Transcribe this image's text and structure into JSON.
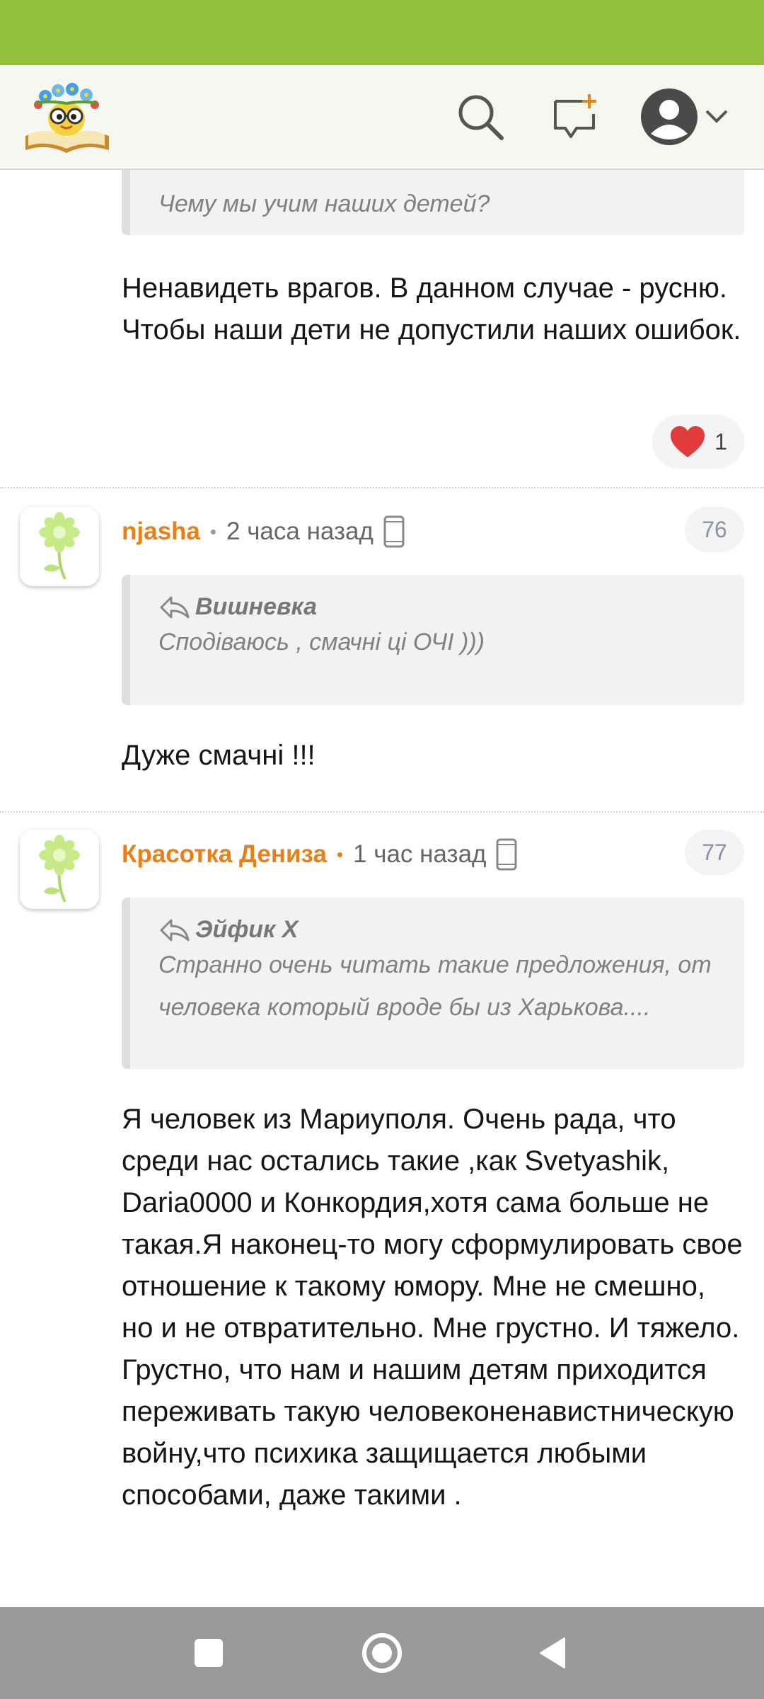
{
  "comments": [
    {
      "quote_text": "Чему мы учим наших детей?",
      "body": "Ненавидеть врагов. В данном случае - русню. Чтобы наши дети не допустили наших ошибок.",
      "likes": "1"
    },
    {
      "author": "njasha",
      "time": "2 часа назад",
      "number": "76",
      "quote_author": "Вишневка",
      "quote_text": "Сподіваюсь , смачні ці ОЧІ )))",
      "body": "Дуже смачні !!!"
    },
    {
      "author": "Красотка Дениза",
      "time": "1 час назад",
      "number": "77",
      "quote_author": "Эйфик Х",
      "quote_text": "Странно очень читать такие предложения, от человека который вроде бы из Харькова....",
      "body": "Я человек из Мариуполя. Очень рада, что среди нас остались такие ,как Svetyashik, Daria0000 и Конкордия,хотя сама больше не такая.Я наконец-то могу сформулировать свое отношение к такому юмору. Мне не смешно, но и не отвратительно. Мне грустно. И тяжело. Грустно, что нам и нашим детям приходится переживать такую человеконенавистническую войну,что психика защищается любыми способами, даже такими ."
    }
  ],
  "colors": {
    "status_bar": "#94c13d",
    "author": "#e8801a",
    "quote_bg": "#f2f2f2"
  },
  "icons": [
    "search-icon",
    "new-post-icon",
    "user-avatar-icon",
    "chevron-down-icon",
    "heart-icon",
    "mobile-device-icon",
    "reply-arrow-icon",
    "flower-icon",
    "square-nav-icon",
    "circle-nav-icon",
    "back-triangle-icon"
  ]
}
